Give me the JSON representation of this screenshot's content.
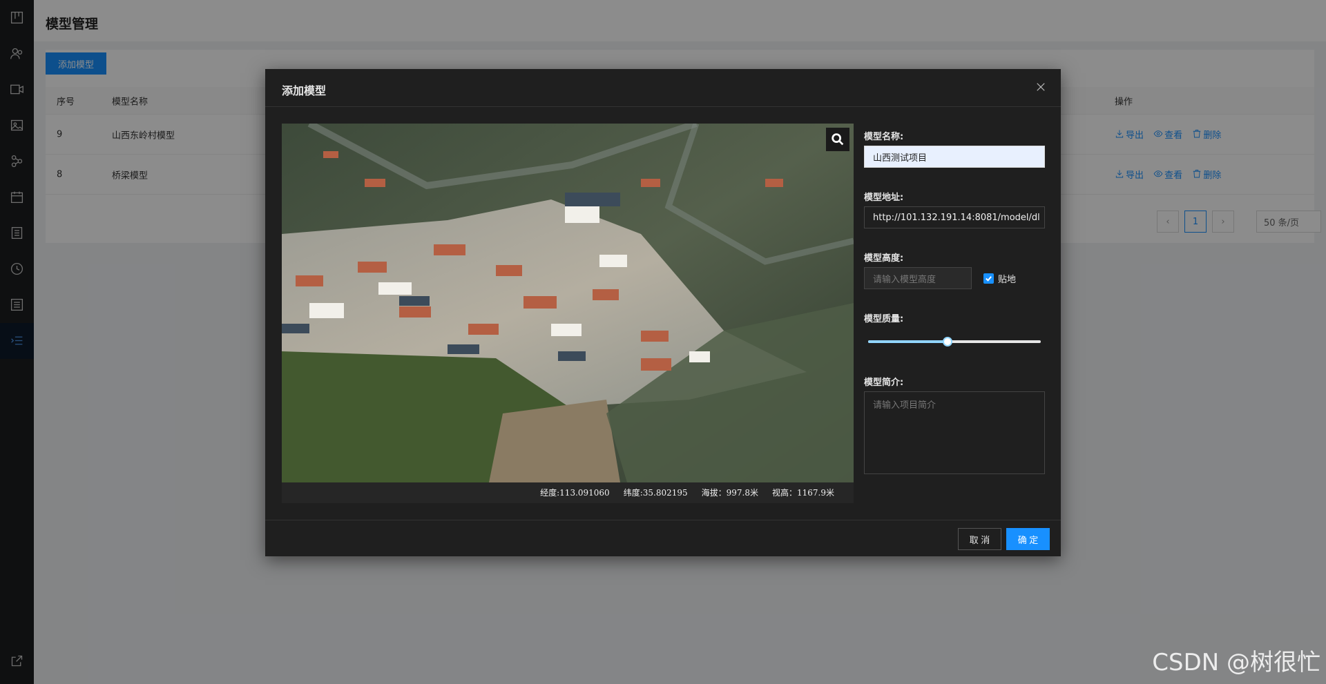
{
  "sidebar": {
    "icons": [
      "board-icon",
      "users-icon",
      "video-icon",
      "image-icon",
      "network-icon",
      "calendar-icon",
      "document-icon",
      "history-icon",
      "list-icon",
      "indent-list-icon"
    ],
    "bottom_icon": "external-link-icon",
    "active_index": 9
  },
  "page": {
    "title": "模型管理",
    "add_button": "添加模型",
    "table": {
      "headers": {
        "idx": "序号",
        "name": "模型名称",
        "ops": "操作"
      },
      "rows": [
        {
          "idx": "9",
          "name": "山西东岭村模型"
        },
        {
          "idx": "8",
          "name": "桥梁模型"
        }
      ],
      "ops": {
        "export": "导出",
        "view": "查看",
        "delete": "删除"
      }
    },
    "pagination": {
      "current": "1",
      "page_size": "50 条/页"
    }
  },
  "modal": {
    "title": "添加模型",
    "viewer": {
      "longitude": "经度:113.091060",
      "latitude": "纬度:35.802195",
      "altitude": "海拔：997.8米",
      "view_height": "视高：1167.9米"
    },
    "form": {
      "name_label": "模型名称:",
      "name_value": "山西测试项目",
      "url_label": "模型地址:",
      "url_value": "http://101.132.191.14:8081/model/dl",
      "height_label": "模型高度:",
      "height_placeholder": "请输入模型高度",
      "clamp_label": "贴地",
      "clamp_checked": true,
      "quality_label": "模型质量:",
      "quality_value": 0.46,
      "intro_label": "模型简介:",
      "intro_placeholder": "请输入项目简介"
    },
    "cancel": "取 消",
    "ok": "确 定"
  },
  "watermark": "CSDN @树很忙",
  "colors": {
    "accent": "#1890ff",
    "modal_bg": "#1f1f1f",
    "sidebar_bg": "#1d1e1f"
  }
}
